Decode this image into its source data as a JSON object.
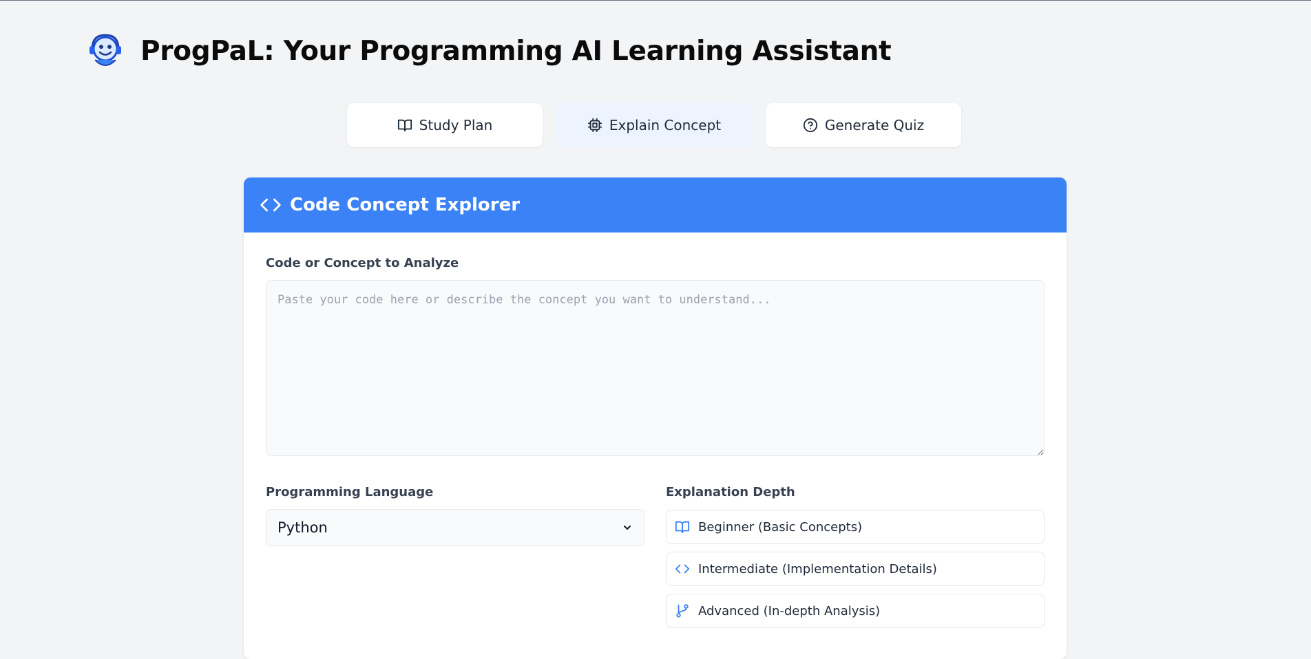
{
  "app": {
    "title": "ProgPaL: Your Programming AI Learning Assistant",
    "logo_icon": "robot-headset-icon"
  },
  "tabs": [
    {
      "label": "Study Plan",
      "icon": "book-open-icon",
      "active": false
    },
    {
      "label": "Explain Concept",
      "icon": "cpu-icon",
      "active": true
    },
    {
      "label": "Generate Quiz",
      "icon": "help-circle-icon",
      "active": false
    }
  ],
  "card": {
    "title": "Code Concept Explorer",
    "icon": "code-icon",
    "header_color": "#3b82f6",
    "code_label": "Code or Concept to Analyze",
    "code_value": "",
    "code_placeholder": "Paste your code here or describe the concept you want to understand...",
    "language_label": "Programming Language",
    "language_value": "Python",
    "depth_label": "Explanation Depth",
    "depth_options": [
      {
        "label": "Beginner (Basic Concepts)",
        "icon": "book-open-icon"
      },
      {
        "label": "Intermediate (Implementation Details)",
        "icon": "code-icon"
      },
      {
        "label": "Advanced (In-depth Analysis)",
        "icon": "git-branch-icon"
      }
    ]
  },
  "colors": {
    "accent": "#3b82f6",
    "background": "#f3f4f6",
    "active_tab": "#eef4ff"
  }
}
